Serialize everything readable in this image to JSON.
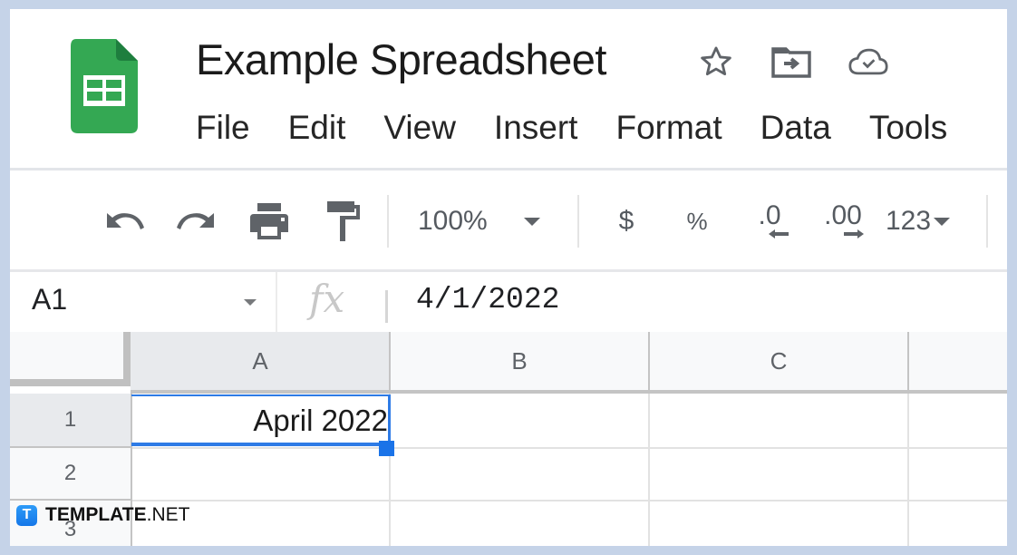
{
  "app": {
    "logo": "google-sheets-logo",
    "title": "Example Spreadsheet",
    "title_icons": [
      "star-icon",
      "move-to-folder-icon",
      "cloud-saved-icon"
    ]
  },
  "menu": [
    "File",
    "Edit",
    "View",
    "Insert",
    "Format",
    "Data",
    "Tools"
  ],
  "toolbar": {
    "icons": [
      "undo-icon",
      "redo-icon",
      "print-icon",
      "paint-format-icon"
    ],
    "zoom": "100%",
    "currency": "$",
    "percent": "%",
    "decrease_decimal": ".0",
    "increase_decimal": ".00",
    "more_formats": "123"
  },
  "formula_bar": {
    "name_box": "A1",
    "fx_label": "fx",
    "value": "4/1/2022"
  },
  "grid": {
    "columns": [
      "A",
      "B",
      "C"
    ],
    "rows": [
      "1",
      "2",
      "3"
    ],
    "selected_cell": "A1",
    "cells": {
      "A1": "April 2022"
    }
  },
  "watermark": {
    "badge": "T",
    "brand": "TEMPLATE",
    "suffix": ".NET"
  },
  "colors": {
    "sheets_green": "#34a853",
    "selection_blue": "#1a73e8",
    "frame_bg": "#c5d3e8"
  }
}
